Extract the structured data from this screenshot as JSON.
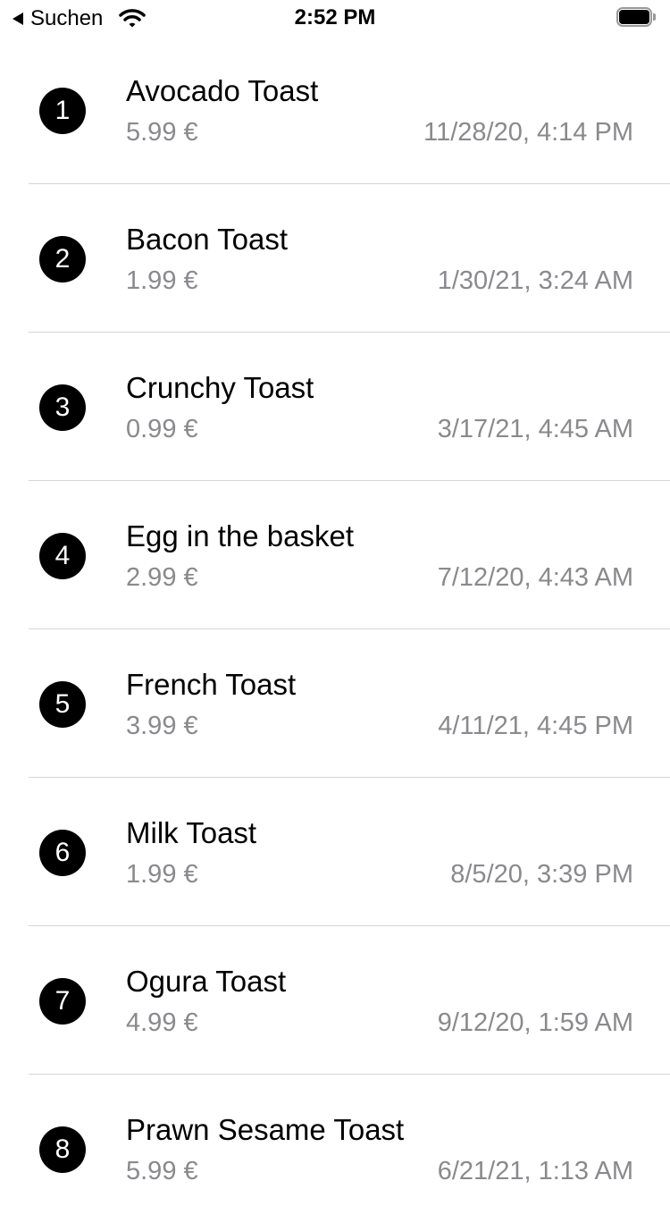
{
  "status_bar": {
    "back_label": "Suchen",
    "time": "2:52 PM"
  },
  "items": [
    {
      "number": "1",
      "name": "Avocado Toast",
      "price": "5.99 €",
      "date": "11/28/20, 4:14 PM"
    },
    {
      "number": "2",
      "name": "Bacon Toast",
      "price": "1.99 €",
      "date": "1/30/21, 3:24 AM"
    },
    {
      "number": "3",
      "name": "Crunchy Toast",
      "price": "0.99 €",
      "date": "3/17/21, 4:45 AM"
    },
    {
      "number": "4",
      "name": "Egg in the basket",
      "price": "2.99 €",
      "date": "7/12/20, 4:43 AM"
    },
    {
      "number": "5",
      "name": "French Toast",
      "price": "3.99 €",
      "date": "4/11/21, 4:45 PM"
    },
    {
      "number": "6",
      "name": "Milk Toast",
      "price": "1.99 €",
      "date": "8/5/20, 3:39 PM"
    },
    {
      "number": "7",
      "name": "Ogura Toast",
      "price": "4.99 €",
      "date": "9/12/20, 1:59 AM"
    },
    {
      "number": "8",
      "name": "Prawn Sesame Toast",
      "price": "5.99 €",
      "date": "6/21/21, 1:13 AM"
    }
  ]
}
